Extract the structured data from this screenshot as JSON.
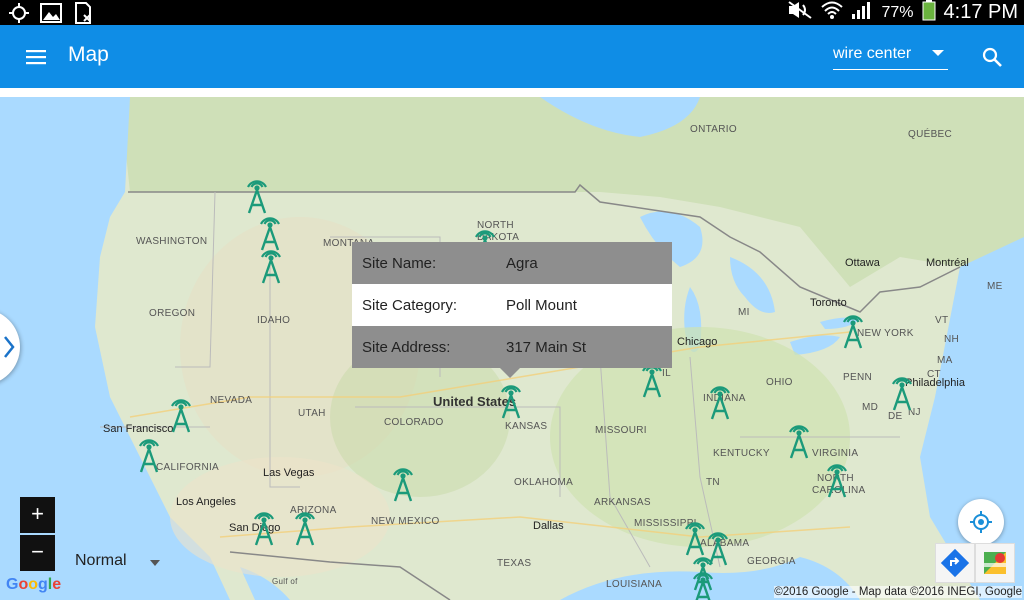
{
  "status_bar": {
    "battery_percent": "77%",
    "time": "4:17 PM",
    "icons": [
      "gps-icon",
      "gallery-icon",
      "sim-icon",
      "mute-icon",
      "wifi-icon",
      "signal-icon",
      "battery-icon"
    ]
  },
  "app_bar": {
    "title": "Map",
    "dropdown_value": "wire center",
    "color": "#0f8de6"
  },
  "map": {
    "labels": {
      "ontario": "ONTARIO",
      "quebec": "QUÉBEC",
      "washington": "WASHINGTON",
      "montana": "MONTANA",
      "north_dakota_1": "NORTH",
      "north_dakota_2": "DAKOTA",
      "oregon": "OREGON",
      "idaho": "IDAHO",
      "nevada": "NEVADA",
      "utah": "UTAH",
      "colorado": "COLORADO",
      "kansas": "KANSAS",
      "missouri": "MISSOURI",
      "il": "IL",
      "indiana": "INDIANA",
      "ohio": "OHIO",
      "penn": "PENN",
      "mi": "MI",
      "ny": "NEW YORK",
      "vt": "VT",
      "nh": "NH",
      "me": "ME",
      "ma": "MA",
      "ct": "CT",
      "md": "MD",
      "nj": "NJ",
      "de": "DE",
      "virginia": "VIRGINIA",
      "kentucky": "KENTUCKY",
      "tn": "TN",
      "nc_1": "NORTH",
      "nc_2": "CAROLINA",
      "california": "CALIFORNIA",
      "arizona": "ARIZONA",
      "new_mexico": "NEW MEXICO",
      "oklahoma": "OKLAHOMA",
      "arkansas": "ARKANSAS",
      "mississippi": "MISSISSIPPI",
      "alabama": "ALABAMA",
      "georgia": "GEORGIA",
      "texas": "TEXAS",
      "louisiana": "LOUISIANA",
      "united_states": "United States",
      "ottawa": "Ottawa",
      "montreal": "Montréal",
      "toronto": "Toronto",
      "chicago": "Chicago",
      "philadelphia": "Philadelphia",
      "san_francisco": "San Francisco",
      "las_vegas": "Las Vegas",
      "los_angeles": "Los Angeles",
      "san_diego": "San Diego",
      "dallas": "Dallas",
      "gulf": "Gulf of"
    },
    "map_type": "Normal",
    "copyright": "©2016 Google - Map data ©2016 INEGI, Google",
    "logo": "Google",
    "tower_color": "#1b9a7a"
  },
  "popup": {
    "rows": [
      {
        "key": "Site Name:",
        "value": "Agra"
      },
      {
        "key": "Site Category:",
        "value": "Poll Mount"
      },
      {
        "key": "Site Address:",
        "value": "317 Main St"
      }
    ]
  },
  "controls": {
    "zoom_in": "+",
    "zoom_out": "−"
  }
}
